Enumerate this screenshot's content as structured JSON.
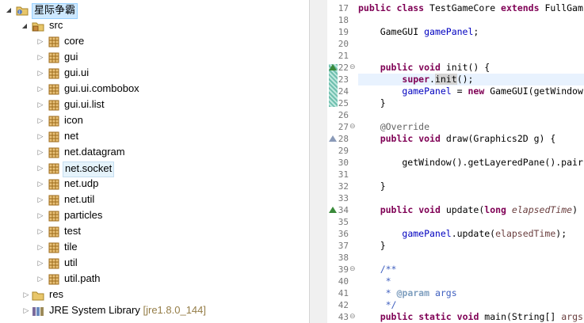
{
  "tree": {
    "project": "星际争霸",
    "src": "src",
    "packages": [
      "core",
      "gui",
      "gui.ui",
      "gui.ui.combobox",
      "gui.ui.list",
      "icon",
      "net",
      "net.datagram",
      "net.socket",
      "net.udp",
      "net.util",
      "particles",
      "test",
      "tile",
      "util",
      "util.path"
    ],
    "selected_package": "net.socket",
    "res": "res",
    "jre": {
      "name": "JRE System Library",
      "version": "[jre1.8.0_144]"
    }
  },
  "editor": {
    "line_numbers": [
      "17",
      "18",
      "19",
      "20",
      "21",
      "22",
      "23",
      "24",
      "25",
      "26",
      "27",
      "28",
      "29",
      "30",
      "31",
      "32",
      "33",
      "34",
      "35",
      "36",
      "37",
      "38",
      "39",
      "40",
      "41",
      "42",
      "43"
    ],
    "current_line": "23",
    "lines": {
      "l17": [
        "public",
        " ",
        "class",
        " TestGameCore ",
        "extends",
        " FullGam"
      ],
      "l19": "    GameGUI ",
      "l19f": "gamePanel",
      "l19e": ";",
      "l22": [
        "    ",
        "public",
        " ",
        "void",
        " init() {"
      ],
      "l23": [
        "        ",
        "super",
        ".",
        "init",
        "();"
      ],
      "l24": [
        "        ",
        "gamePanel",
        " = ",
        "new",
        " GameGUI(getWindow"
      ],
      "l25": "    }",
      "l27": "    @Override",
      "l28": [
        "    ",
        "public",
        " ",
        "void",
        " draw(Graphics2D g) {"
      ],
      "l30": "        getWindow().getLayeredPane().pair",
      "l32": "    }",
      "l34": [
        "    ",
        "public",
        " ",
        "void",
        " update(",
        "long",
        " ",
        "elapsedTime",
        ")"
      ],
      "l36": [
        "        ",
        "gamePanel",
        ".update(",
        "elapsedTime",
        ");"
      ],
      "l37": "    }",
      "l39": "    /**",
      "l40": "     *",
      "l41": [
        "     * ",
        "@param",
        " ",
        "args"
      ],
      "l42": "     */",
      "l43": [
        "    ",
        "public",
        " ",
        "static",
        " ",
        "void",
        " main(String[] ",
        "args"
      ]
    }
  }
}
